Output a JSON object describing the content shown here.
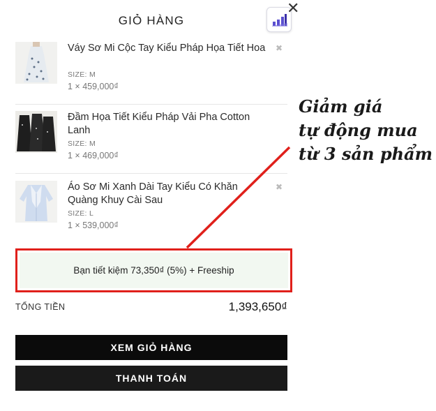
{
  "cart": {
    "title": "GIỎ HÀNG",
    "close_symbol": "✕",
    "remove_symbol": "✖",
    "items": [
      {
        "name": "Váy Sơ Mi Cộc Tay Kiểu Pháp Họa Tiết Hoa",
        "size_label": "SIZE: M",
        "price_line": "1 × 459,000₫"
      },
      {
        "name": "Đầm Họa Tiết Kiểu Pháp Vải Pha Cotton Lanh",
        "size_label": "SIZE: M",
        "price_line": "1 × 469,000₫"
      },
      {
        "name": "Áo Sơ Mi Xanh Dài Tay Kiểu Có Khăn Quàng Khuy Cài Sau",
        "size_label": "SIZE: L",
        "price_line": "1 × 539,000₫"
      }
    ],
    "promo_text": "Bạn tiết kiệm 73,350₫ (5%) + Freeship",
    "total_label": "TỔNG TIỀN",
    "total_value": "1,393,650₫",
    "view_cart_label": "XEM GIỎ HÀNG",
    "checkout_label": "THANH TOÁN"
  },
  "annotation": {
    "lines": [
      "Giảm giá",
      "tự động mua",
      "từ 3 sản phẩm"
    ]
  },
  "colors": {
    "highlight_border": "#e0201b",
    "promo_background": "#f2f8f1",
    "button_background": "#0b0b0b",
    "widget_icon": "#5a4fcf"
  },
  "icons": {
    "close": "close-icon",
    "remove": "remove-item-icon",
    "widget": "bar-chart-widget-icon"
  }
}
